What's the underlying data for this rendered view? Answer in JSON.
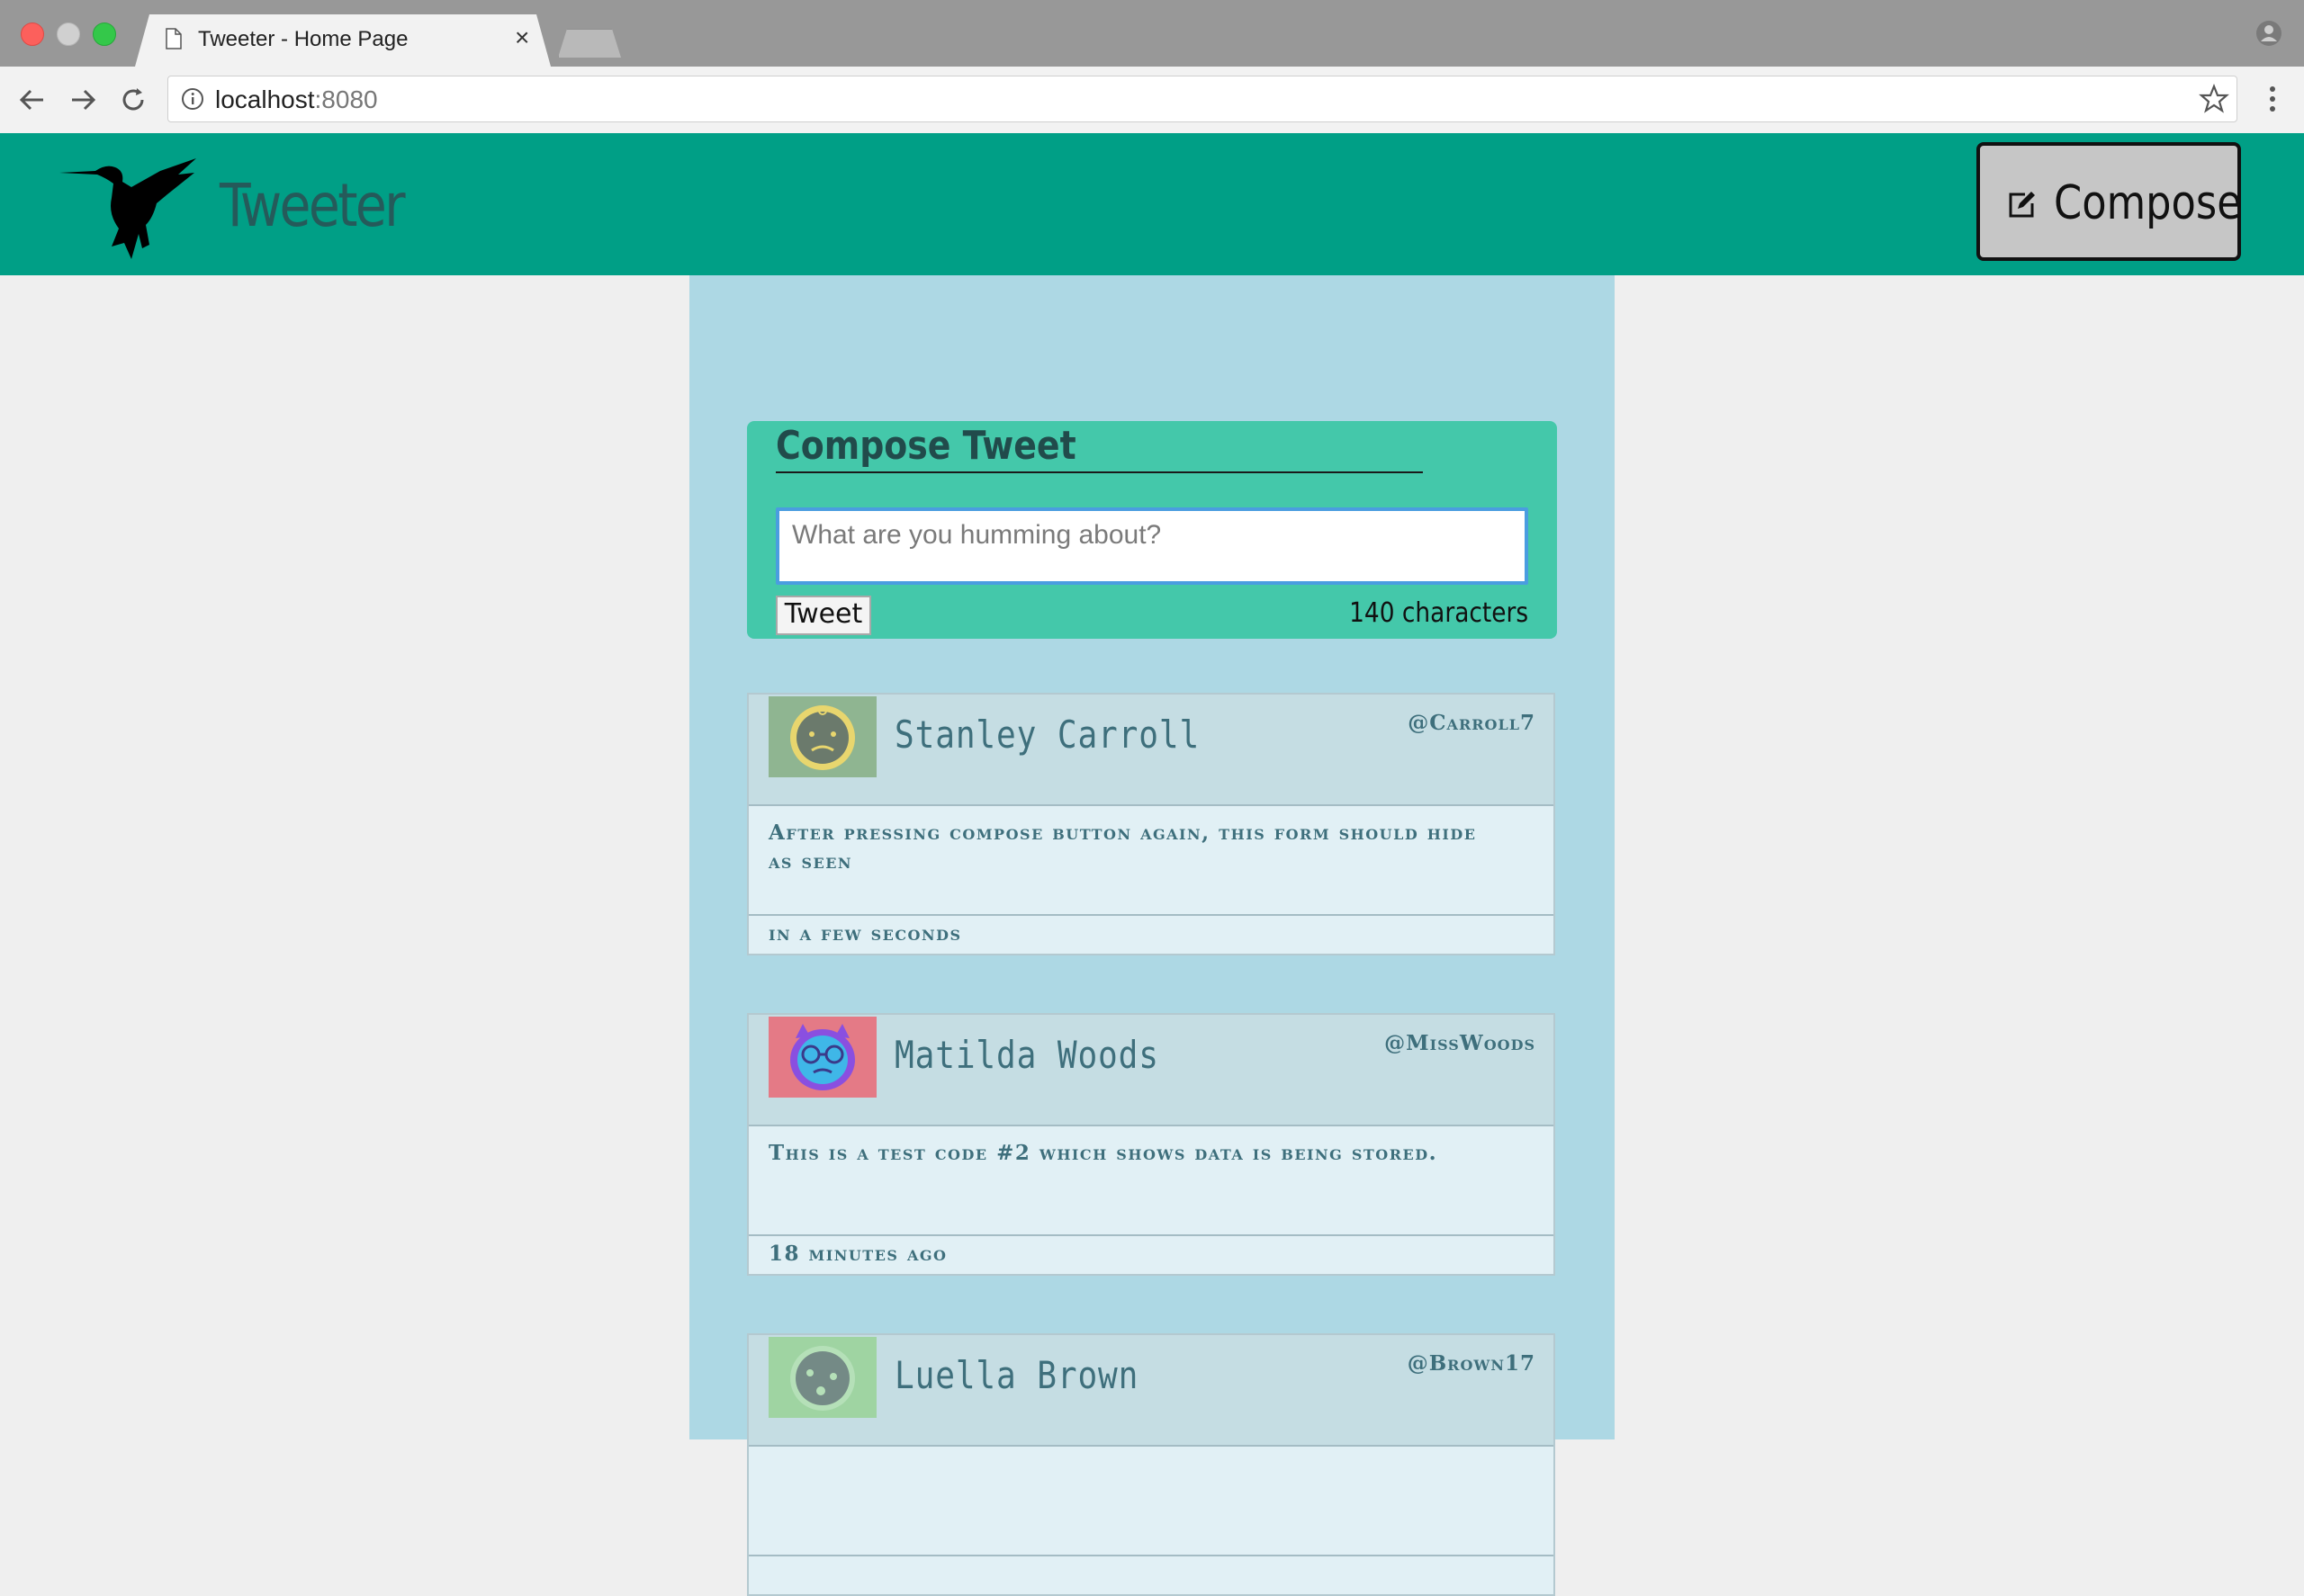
{
  "browser": {
    "tab_title": "Tweeter - Home Page",
    "tab_close": "×",
    "url_host": "localhost",
    "url_port": ":8080"
  },
  "header": {
    "brand": "Tweeter",
    "compose_label": "Compose",
    "colors": {
      "bar": "#009f86",
      "brand_text": "#255a5a"
    }
  },
  "new_tweet": {
    "title": "Compose Tweet",
    "placeholder": "What are you humming about?",
    "value": "",
    "submit_label": "Tweet",
    "counter": "140 characters"
  },
  "tweets": [
    {
      "name": "Stanley Carroll",
      "handle": "@Carroll7",
      "content": "After pressing compose button again, this form should hide as seen",
      "time": "in a few seconds",
      "avatar_color": "#8fb591"
    },
    {
      "name": "Matilda Woods",
      "handle": "@MissWoods",
      "content": "This is a test code #2 which shows data is being stored.",
      "time": "18 minutes ago",
      "avatar_color": "#e47a86"
    },
    {
      "name": "Luella Brown",
      "handle": "@Brown17",
      "content": "",
      "time": "",
      "avatar_color": "#9fd4a2"
    }
  ]
}
